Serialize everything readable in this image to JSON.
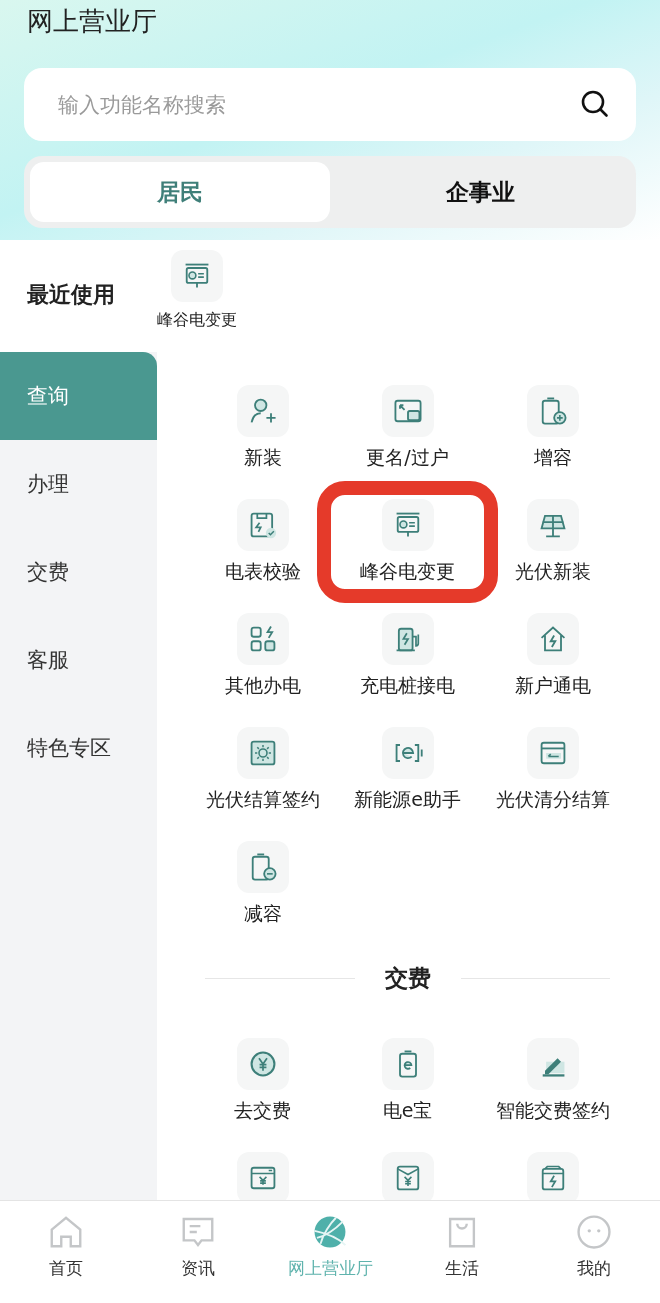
{
  "header": {
    "title": "网上营业厅",
    "search": {
      "placeholder": "输入功能名称搜索"
    },
    "tabs": [
      {
        "label": "居民",
        "selected": true
      },
      {
        "label": "企事业",
        "selected": false
      }
    ]
  },
  "recent": {
    "title": "最近使用",
    "items": [
      {
        "label": "峰谷电变更"
      }
    ]
  },
  "sidebar": {
    "items": [
      {
        "label": "查询",
        "selected": true
      },
      {
        "label": "办理",
        "selected": false
      },
      {
        "label": "交费",
        "selected": false
      },
      {
        "label": "客服",
        "selected": false
      },
      {
        "label": "特色专区",
        "selected": false
      }
    ]
  },
  "sections": [
    {
      "items": [
        {
          "label": "新装",
          "highlighted": false
        },
        {
          "label": "更名/过户",
          "highlighted": false
        },
        {
          "label": "增容",
          "highlighted": false
        },
        {
          "label": "电表校验",
          "highlighted": false
        },
        {
          "label": "峰谷电变更",
          "highlighted": true
        },
        {
          "label": "光伏新装",
          "highlighted": false
        },
        {
          "label": "其他办电",
          "highlighted": false
        },
        {
          "label": "充电桩接电",
          "highlighted": false
        },
        {
          "label": "新户通电",
          "highlighted": false
        },
        {
          "label": "光伏结算签约",
          "highlighted": false
        },
        {
          "label": "新能源e助手",
          "highlighted": false
        },
        {
          "label": "光伏清分结算",
          "highlighted": false
        },
        {
          "label": "减容",
          "highlighted": false
        }
      ]
    },
    {
      "title": "交费",
      "items": [
        {
          "label": "去交费",
          "highlighted": false
        },
        {
          "label": "电e宝",
          "highlighted": false
        },
        {
          "label": "智能交费签约",
          "highlighted": false
        },
        {
          "highlighted": false
        },
        {
          "highlighted": false
        },
        {
          "highlighted": false
        }
      ]
    }
  ],
  "bottom_nav": [
    {
      "label": "首页",
      "selected": false
    },
    {
      "label": "资讯",
      "selected": false
    },
    {
      "label": "网上营业厅",
      "selected": true
    },
    {
      "label": "生活",
      "selected": false
    },
    {
      "label": "我的",
      "selected": false
    }
  ]
}
